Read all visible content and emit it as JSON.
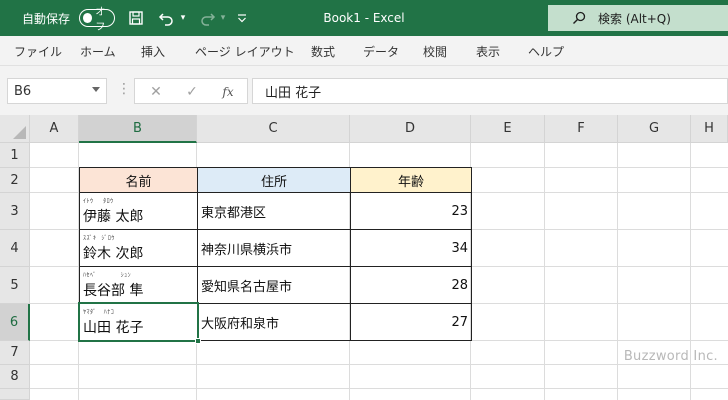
{
  "titlebar": {
    "autosave_label": "自動保存",
    "autosave_state": "オフ",
    "doc_title": "Book1  -  Excel",
    "search_label": "検索 (Alt+Q)",
    "bg_color": "#217346"
  },
  "ribbon": {
    "tabs": [
      "ファイル",
      "ホーム",
      "挿入",
      "ページ レイアウト",
      "数式",
      "データ",
      "校閲",
      "表示",
      "ヘルプ"
    ]
  },
  "formula_bar": {
    "name_box": "B6",
    "fx_label": "fx",
    "formula": "山田 花子"
  },
  "grid": {
    "columns": [
      "A",
      "B",
      "C",
      "D",
      "E",
      "F",
      "G",
      "H"
    ],
    "rows": [
      "1",
      "2",
      "3",
      "4",
      "5",
      "6",
      "7",
      "8"
    ],
    "selected_cell": "B6",
    "headers": {
      "name": "名前",
      "address": "住所",
      "age": "年齢",
      "name_color": "#fce4d6",
      "address_color": "#ddebf7",
      "age_color": "#fff2cc"
    },
    "records": [
      {
        "furigana": "ｲﾄｳ    ﾀﾛｳ",
        "name": "伊藤 太郎",
        "address": "東京都港区",
        "age": "23"
      },
      {
        "furigana": "ｽｽﾞｷ  ｼﾞﾛｳ",
        "name": "鈴木 次郎",
        "address": "神奈川県横浜市",
        "age": "34"
      },
      {
        "furigana": "ﾊｾﾍﾞ          ｼｭﾝ",
        "name": "長谷部 隼",
        "address": "愛知県名古屋市",
        "age": "28"
      },
      {
        "furigana": "ﾔﾏﾀﾞ   ﾊﾅｺ",
        "name": "山田 花子",
        "address": "大阪府和泉市",
        "age": "27"
      }
    ]
  },
  "watermark": "Buzzword Inc."
}
